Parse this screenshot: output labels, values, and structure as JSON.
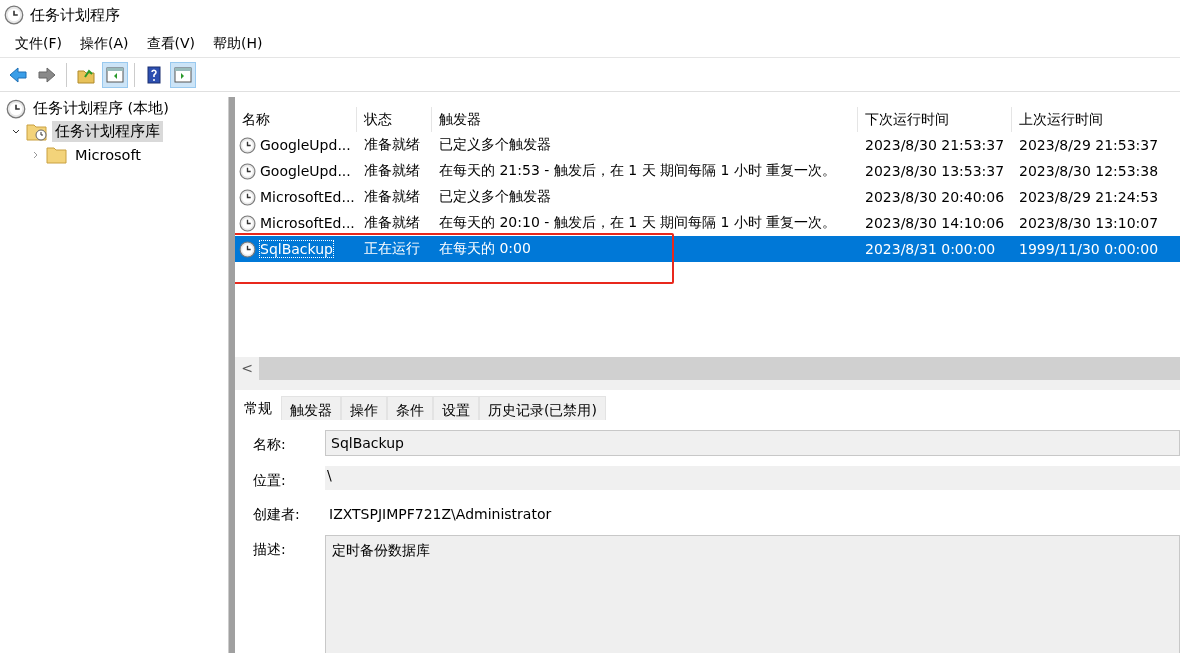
{
  "window": {
    "title": "任务计划程序"
  },
  "menu": [
    "文件(F)",
    "操作(A)",
    "查看(V)",
    "帮助(H)"
  ],
  "toolbar": [
    {
      "kind": "back",
      "on": false
    },
    {
      "kind": "forward",
      "on": false
    },
    {
      "kind": "up-folder",
      "on": false
    },
    {
      "kind": "console-tree",
      "on": true
    },
    {
      "kind": "help",
      "on": false
    },
    {
      "kind": "action-pane",
      "on": true
    }
  ],
  "tree": [
    {
      "label": "任务计划程序 (本地)",
      "kind": "clock",
      "selected": false,
      "children": [
        {
          "label": "任务计划程序库",
          "kind": "clock-folder",
          "expanded": true,
          "selected": true,
          "children": [
            {
              "label": "Microsoft",
              "kind": "folder",
              "expanded": false,
              "selected": false
            }
          ]
        }
      ]
    }
  ],
  "table": {
    "columns": [
      "名称",
      "状态",
      "触发器",
      "下次运行时间",
      "上次运行时间"
    ],
    "rows": [
      {
        "name": "GoogleUpd...",
        "status": "准备就绪",
        "trigger": "已定义多个触发器",
        "next": "2023/8/30 21:53:37",
        "last": "2023/8/29 21:53:37",
        "selected": false
      },
      {
        "name": "GoogleUpd...",
        "status": "准备就绪",
        "trigger": "在每天的 21:53 - 触发后，在 1 天 期间每隔 1 小时 重复一次。",
        "next": "2023/8/30 13:53:37",
        "last": "2023/8/30 12:53:38",
        "selected": false
      },
      {
        "name": "MicrosoftEd...",
        "status": "准备就绪",
        "trigger": "已定义多个触发器",
        "next": "2023/8/30 20:40:06",
        "last": "2023/8/29 21:24:53",
        "selected": false
      },
      {
        "name": "MicrosoftEd...",
        "status": "准备就绪",
        "trigger": "在每天的 20:10 - 触发后，在 1 天 期间每隔 1 小时 重复一次。",
        "next": "2023/8/30 14:10:06",
        "last": "2023/8/30 13:10:07",
        "selected": false
      },
      {
        "name": "SqlBackup",
        "status": "正在运行",
        "trigger": "在每天的 0:00",
        "next": "2023/8/31 0:00:00",
        "last": "1999/11/30 0:00:00",
        "selected": true
      }
    ],
    "scroll_button": "<"
  },
  "tabs": [
    {
      "label": "常规",
      "selected": true
    },
    {
      "label": "触发器",
      "selected": false
    },
    {
      "label": "操作",
      "selected": false
    },
    {
      "label": "条件",
      "selected": false
    },
    {
      "label": "设置",
      "selected": false
    },
    {
      "label": "历史记录(已禁用)",
      "selected": false
    }
  ],
  "details": [
    {
      "label": "名称:",
      "value": "SqlBackup",
      "kind": "input"
    },
    {
      "label": "位置:",
      "value": "\\",
      "kind": "readonly"
    },
    {
      "label": "创建者:",
      "value": "IZXTSPJIMPF721Z\\Administrator",
      "kind": "text"
    },
    {
      "label": "描述:",
      "value": "定时备份数据库",
      "kind": "textarea"
    }
  ]
}
